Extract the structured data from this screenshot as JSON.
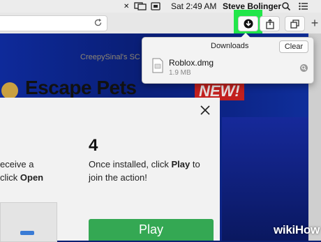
{
  "menubar": {
    "time": "Sat 2:49 AM",
    "user": "Steve Bolinger"
  },
  "background": {
    "banner_text": "CreepySinal's SC",
    "game_title": "Escape Pets",
    "badge": "NEW!"
  },
  "downloads": {
    "title": "Downloads",
    "clear_label": "Clear",
    "file_name": "Roblox.dmg",
    "file_size": "1.9 MB"
  },
  "dialog": {
    "step3": {
      "line1": "eceive a",
      "line2_prefix": "click ",
      "line2_bold": "Open"
    },
    "step4": {
      "number": "4",
      "text_prefix": "Once installed, click ",
      "text_bold": "Play",
      "text_suffix": " to",
      "line2": "join the action!"
    },
    "play_label": "Play"
  },
  "watermark": "wikiHow",
  "colors": {
    "highlight": "#22e64a",
    "play": "#34a853",
    "page_bg": "#0b1f73"
  }
}
